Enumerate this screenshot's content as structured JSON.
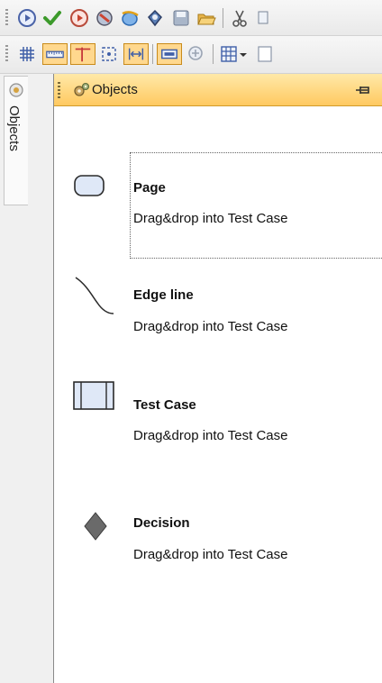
{
  "toolbar_top": {
    "icons": [
      "run-icon",
      "check-icon",
      "record-icon",
      "settings-icon",
      "browser-icon",
      "plugin-icon",
      "save-icon",
      "open-folder-icon",
      "cut-icon"
    ]
  },
  "toolbar_second": {
    "icons": [
      "grid-icon",
      "ruler-icon",
      "guides-icon",
      "snap-icon",
      "fit-width-icon",
      "frame-icon",
      "zoom-icon",
      "table-icon",
      "dropdown-arrow-icon",
      "page-icon"
    ]
  },
  "side_tab": {
    "label": "Objects"
  },
  "panel": {
    "title": "Objects",
    "items": [
      {
        "name": "Page",
        "description": "Drag&drop into Test Case",
        "icon": "rounded-rect-icon"
      },
      {
        "name": "Edge line",
        "description": "Drag&drop into Test Case",
        "icon": "curve-line-icon"
      },
      {
        "name": "Test Case",
        "description": "Drag&drop into Test Case",
        "icon": "process-box-icon"
      },
      {
        "name": "Decision",
        "description": "Drag&drop into Test Case",
        "icon": "diamond-icon"
      }
    ]
  },
  "colors": {
    "header_top": "#ffe9a8",
    "header_bottom": "#ffc961",
    "shape_fill": "#dfe8f7"
  }
}
